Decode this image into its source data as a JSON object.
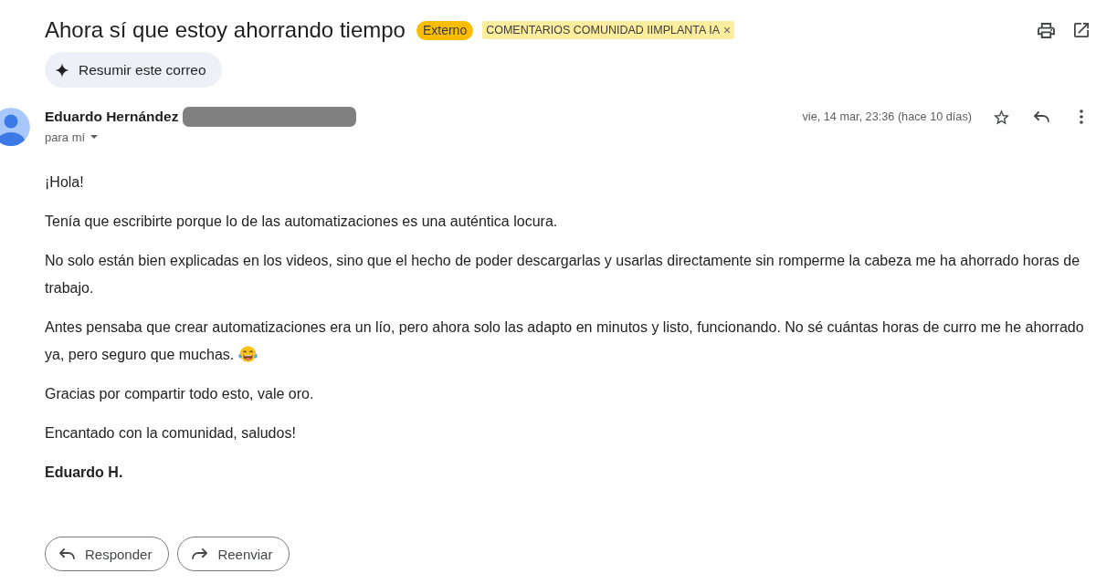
{
  "subject": "Ahora sí que estoy ahorrando tiempo",
  "chips": [
    {
      "kind": "status",
      "label": "Externo"
    },
    {
      "kind": "label",
      "label": "COMENTARIOS COMUNIDAD IIMPLANTA IA",
      "remove": "×"
    }
  ],
  "summarize_button": {
    "label": "Resumir este correo"
  },
  "sender": {
    "name": "Eduardo Hernández",
    "recipient": "para mí"
  },
  "date": "vie, 14 mar, 23:36 (hace 10 días)",
  "starred": false,
  "body": [
    {
      "kind": "text",
      "text": "¡Hola!"
    },
    {
      "kind": "text",
      "text": "Tenía que escribirte porque lo de las automatizaciones es una auténtica locura."
    },
    {
      "kind": "text",
      "text": "No solo están bien explicadas en los videos, sino que el hecho de poder descargarlas y usarlas directamente sin romperme la cabeza me ha ahorrado horas de trabajo."
    },
    {
      "kind": "text_emoji",
      "lines": [
        "Antes pensaba que crear automatizaciones era un lío, pero ahora solo las adapto en minutos y listo, funcionando. No sé cuántas horas de curro me he ahorrado",
        "ya, pero seguro que muchas."
      ]
    },
    {
      "kind": "text",
      "text": "Gracias por compartir todo esto, vale oro."
    },
    {
      "kind": "text",
      "text": "Encantado con la comunidad, saludos!"
    },
    {
      "kind": "signature",
      "text": "Eduardo H."
    }
  ],
  "buttons": [
    {
      "kind": "reply",
      "label": "Responder"
    },
    {
      "kind": "forward",
      "label": "Reenviar"
    }
  ]
}
